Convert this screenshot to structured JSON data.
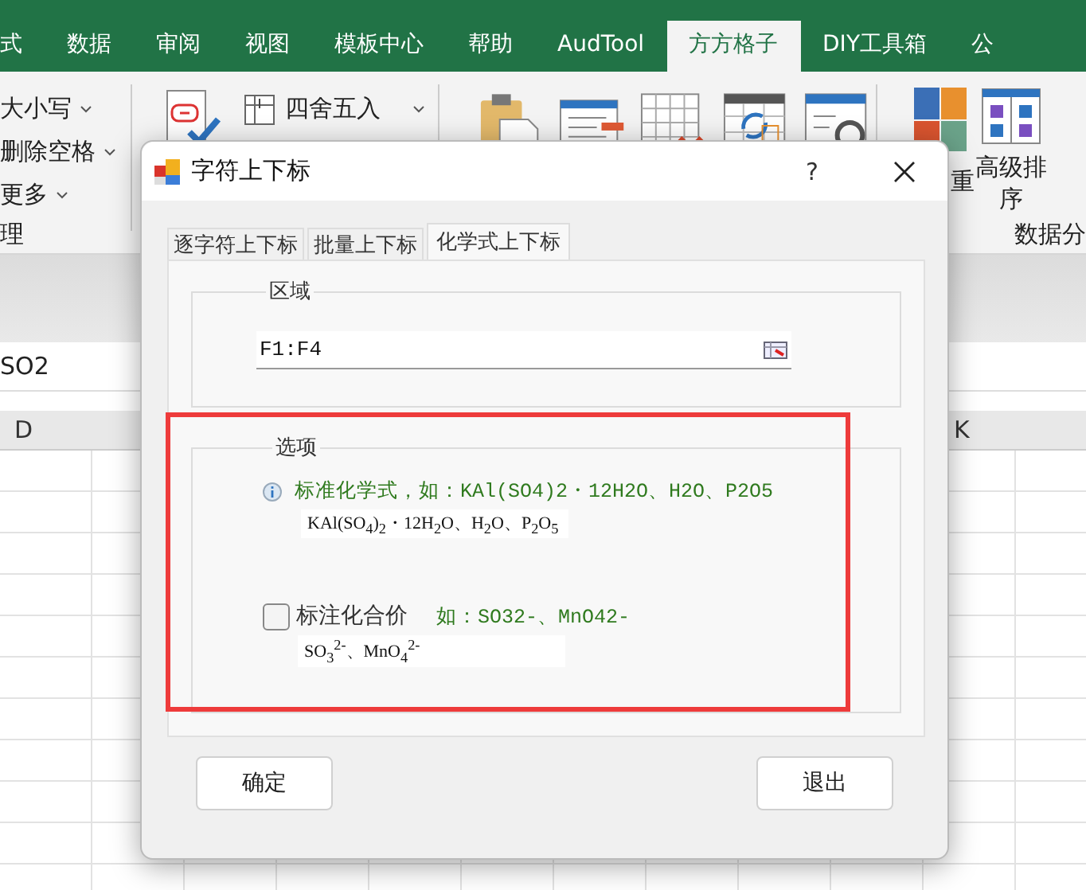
{
  "ribbon_tabs": [
    {
      "label": "式",
      "selected": false
    },
    {
      "label": "数据",
      "selected": false
    },
    {
      "label": "审阅",
      "selected": false
    },
    {
      "label": "视图",
      "selected": false
    },
    {
      "label": "模板中心",
      "selected": false
    },
    {
      "label": "帮助",
      "selected": false
    },
    {
      "label": "AudTool",
      "selected": false
    },
    {
      "label": "方方格子",
      "selected": true
    },
    {
      "label": "DIY工具箱",
      "selected": false
    },
    {
      "label": "公",
      "selected": false
    }
  ],
  "ribbon": {
    "text_commands": [
      "大小写",
      "删除空格",
      "更多"
    ],
    "left_group_label": "理",
    "round_command": "四舍五入",
    "partial_label": "重",
    "sort_command": "高级排序",
    "right_group_label": "数据分"
  },
  "formula_bar": {
    "value": "SO2"
  },
  "column_headers": [
    "D",
    "K"
  ],
  "dialog": {
    "title": "字符上下标",
    "help": "?",
    "tabs": [
      {
        "label": "逐字符上下标",
        "selected": false
      },
      {
        "label": "批量上下标",
        "selected": false
      },
      {
        "label": "化学式上下标",
        "selected": true
      }
    ],
    "range_group": {
      "legend": "区域",
      "value": "F1:F4"
    },
    "options_group": {
      "legend": "选项",
      "options": [
        {
          "kind": "info",
          "label": "标准化学式，如：KAl(SO4)2・12H2O、H2O、P2O5",
          "preview": "KAl(SO$_{4}$)$_{2}$・12H$_{2}$O、H$_{2}$O、P$_{2}$O$_{5}$"
        },
        {
          "kind": "checkbox",
          "checked": false,
          "label": "标注化合价",
          "example": "如：SO32-、MnO42-",
          "preview": "SO$_{3}$$^{2-}$、MnO$_{4}$$^{2-}$"
        }
      ]
    },
    "buttons": [
      "确定",
      "退出"
    ]
  }
}
